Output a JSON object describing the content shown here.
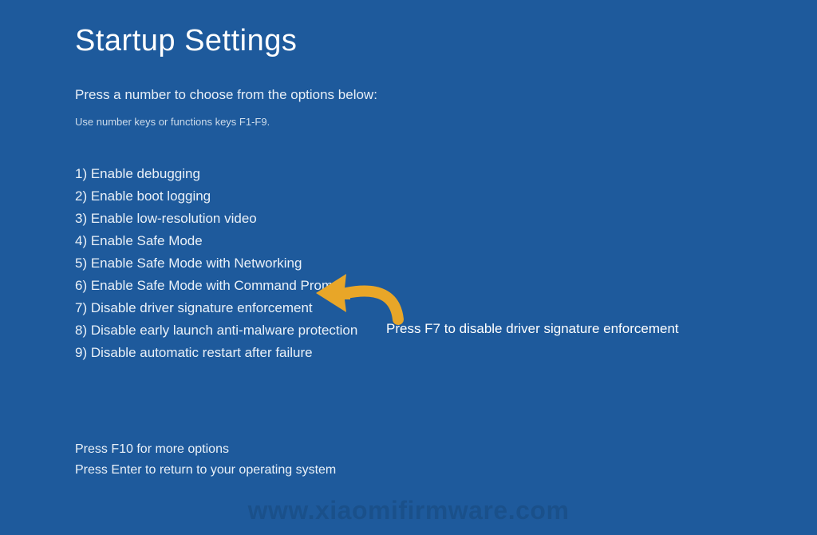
{
  "title": "Startup Settings",
  "instruction": "Press a number to choose from the options below:",
  "sub_instruction": "Use number keys or functions keys F1-F9.",
  "options": [
    "1) Enable debugging",
    "2) Enable boot logging",
    "3) Enable low-resolution video",
    "4) Enable Safe Mode",
    "5) Enable Safe Mode with Networking",
    "6) Enable Safe Mode with Command Prompt",
    "7) Disable driver signature enforcement",
    "8) Disable early launch anti-malware protection",
    "9) Disable automatic restart after failure"
  ],
  "footer": {
    "more_options": "Press F10 for more options",
    "return": "Press Enter to return to your operating system"
  },
  "annotation": {
    "text": "Press F7 to disable driver signature enforcement",
    "arrow_color": "#e8a628"
  },
  "watermark": "www.xiaomifirmware.com"
}
